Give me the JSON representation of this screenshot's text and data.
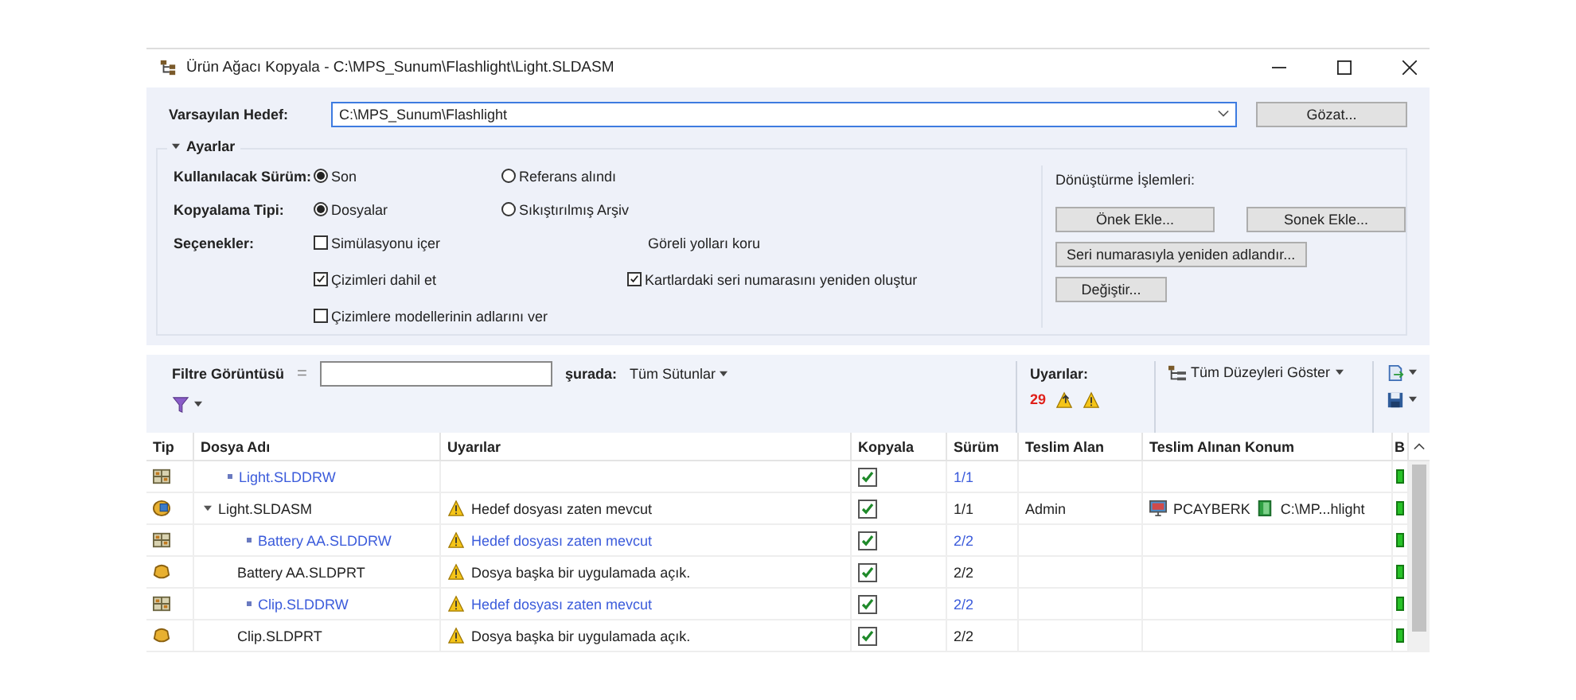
{
  "window": {
    "title": "Ürün Ağacı Kopyala - C:\\MPS_Sunum\\Flashlight\\Light.SLDASM"
  },
  "target": {
    "label": "Varsayılan Hedef:",
    "value": "C:\\MPS_Sunum\\Flashlight",
    "browse_button": "Gözat..."
  },
  "settings": {
    "title": "Ayarlar",
    "expanded": true,
    "version": {
      "label": "Kullanılacak Sürüm:",
      "options": [
        {
          "label": "Son",
          "selected": true
        },
        {
          "label": "Referans alındı",
          "selected": false
        }
      ]
    },
    "copy_type": {
      "label": "Kopyalama Tipi:",
      "options": [
        {
          "label": "Dosyalar",
          "selected": true
        },
        {
          "label": "Sıkıştırılmış Arşiv",
          "selected": false
        }
      ]
    },
    "options": {
      "label": "Seçenekler:",
      "items": [
        {
          "kind": "checkbox",
          "label": "Simülasyonu içer",
          "checked": false
        },
        {
          "kind": "text",
          "label": "Göreli yolları koru"
        },
        {
          "kind": "checkbox",
          "label": "Çizimleri dahil et",
          "checked": true
        },
        {
          "kind": "checkbox",
          "label": "Kartlardaki seri numarasını yeniden oluştur",
          "checked": true
        },
        {
          "kind": "checkbox",
          "label": "Çizimlere modellerinin adlarını ver",
          "checked": false
        }
      ]
    },
    "conversions": {
      "title": "Dönüştürme İşlemleri:",
      "buttons": [
        "Önek Ekle...",
        "Sonek Ekle...",
        "Seri numarasıyla yeniden adlandır...",
        "Değiştir..."
      ]
    }
  },
  "toolbar": {
    "filter_label": "Filtre Görüntüsü",
    "operator": "=",
    "scope_label": "şurada:",
    "scope_value": "Tüm Sütunlar",
    "warnings_label": "Uyarılar:",
    "warnings_count": "29",
    "levels_button": "Tüm Düzeyleri Göster"
  },
  "table": {
    "columns": [
      "Tip",
      "Dosya Adı",
      "Uyarılar",
      "Kopyala",
      "Sürüm",
      "Teslim Alan",
      "Teslim Alınan Konum",
      "B"
    ],
    "rows": [
      {
        "kind": "drawing",
        "name": "Light.SLDDRW",
        "highlighted": true,
        "copy": true,
        "version": "1/1"
      },
      {
        "kind": "assembly",
        "name": "Light.SLDASM",
        "highlighted": false,
        "expanded": true,
        "warning": "Hedef dosyası zaten mevcut",
        "copy": true,
        "version": "1/1",
        "checked_out_by": "Admin",
        "location_computer": "PCAYBERK",
        "location_path": "C:\\MP...hlight",
        "children": [
          {
            "kind": "drawing",
            "name": "Battery AA.SLDDRW",
            "highlighted": true,
            "warning": "Hedef dosyası zaten mevcut",
            "copy": true,
            "version": "2/2"
          },
          {
            "kind": "part",
            "name": "Battery AA.SLDPRT",
            "highlighted": false,
            "warning": "Dosya başka bir uygulamada açık.",
            "copy": true,
            "version": "2/2"
          },
          {
            "kind": "drawing",
            "name": "Clip.SLDDRW",
            "highlighted": true,
            "warning": "Hedef dosyası zaten mevcut",
            "copy": true,
            "version": "2/2"
          },
          {
            "kind": "part",
            "name": "Clip.SLDPRT",
            "highlighted": false,
            "warning": "Dosya başka bir uygulamada açık.",
            "copy": true,
            "version": "2/2"
          }
        ]
      }
    ]
  }
}
